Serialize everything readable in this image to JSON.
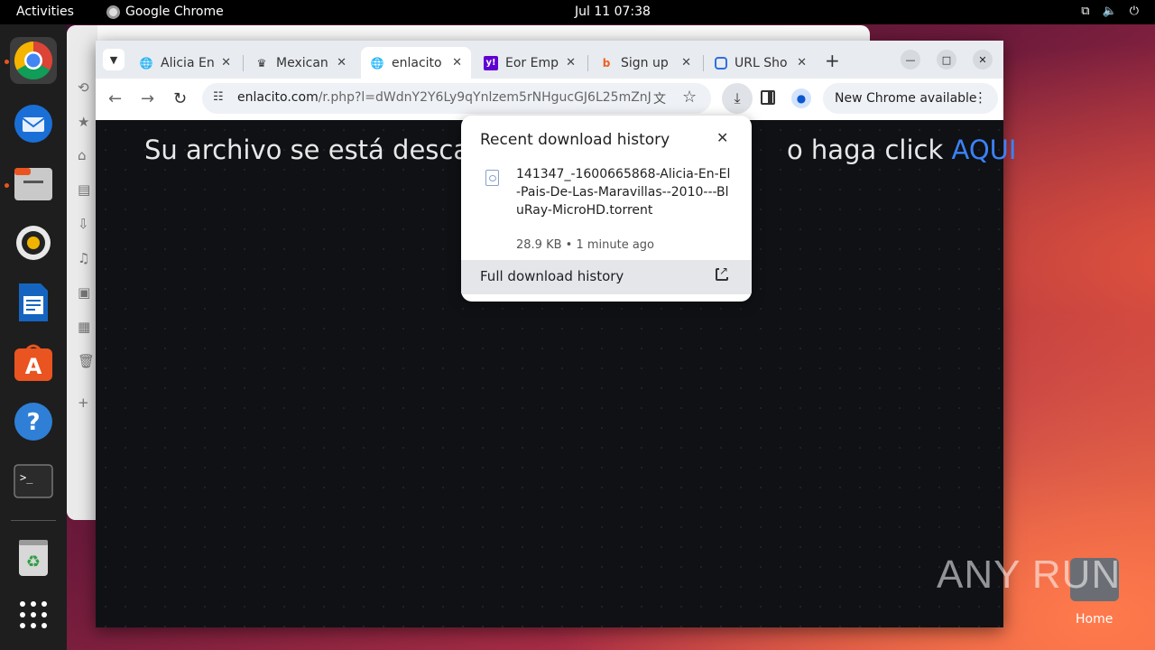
{
  "topbar": {
    "activities": "Activities",
    "app_name": "Google Chrome",
    "clock": "Jul 11  07:38"
  },
  "desktop": {
    "watermark": "ANY RUN",
    "home_label": "Home"
  },
  "browser": {
    "tabs": [
      {
        "title": "Alicia En",
        "icon": "globe-icon"
      },
      {
        "title": "Mexican",
        "icon": "crown-icon"
      },
      {
        "title": "enlacito",
        "icon": "globe-icon"
      },
      {
        "title": "Eor Emp",
        "icon": "yahoo-icon"
      },
      {
        "title": "Sign up",
        "icon": "bitly-icon"
      },
      {
        "title": "URL Sho",
        "icon": "urlshortener-icon"
      }
    ],
    "url_host": "enlacito.com",
    "url_rest": "/r.php?l=dWdnY2Y6Ly9qYnlzem5rNHgucGJ6L25mZnJnZi...",
    "update_button": "New Chrome available"
  },
  "page": {
    "headline_start": "Su archivo se está descarg",
    "headline_end": "o haga click ",
    "headline_link": "AQUI"
  },
  "download_bubble": {
    "heading": "Recent download history",
    "file_name": "141347_-1600665868-Alicia-En-El-Pais-De-Las-Maravillas--2010---BluRay-MicroHD.torrent",
    "file_meta": "28.9 KB • 1 minute ago",
    "full_history": "Full download history"
  },
  "colors": {
    "accent_link": "#3b82f6",
    "ubuntu_orange": "#e95420"
  }
}
